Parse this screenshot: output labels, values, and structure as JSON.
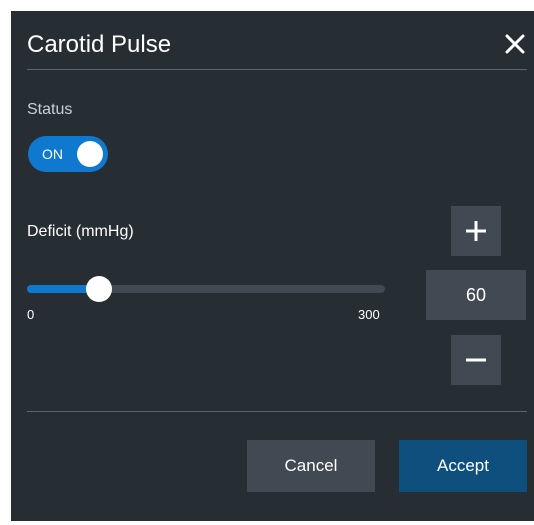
{
  "dialog": {
    "title": "Carotid Pulse"
  },
  "status": {
    "label": "Status",
    "toggle_text": "ON",
    "toggle_on": true
  },
  "deficit": {
    "label": "Deficit (mmHg)",
    "value": "60",
    "min_label": "0",
    "max_label": "300",
    "slider_fraction": 0.2
  },
  "buttons": {
    "cancel_label": "Cancel",
    "accept_label": "Accept"
  },
  "icons": {
    "close": "close-icon",
    "plus": "plus-icon",
    "minus": "minus-icon"
  },
  "colors": {
    "background": "#262d33",
    "accent": "#0f78cf",
    "accept": "#0f4f7d",
    "control": "#414a52"
  }
}
